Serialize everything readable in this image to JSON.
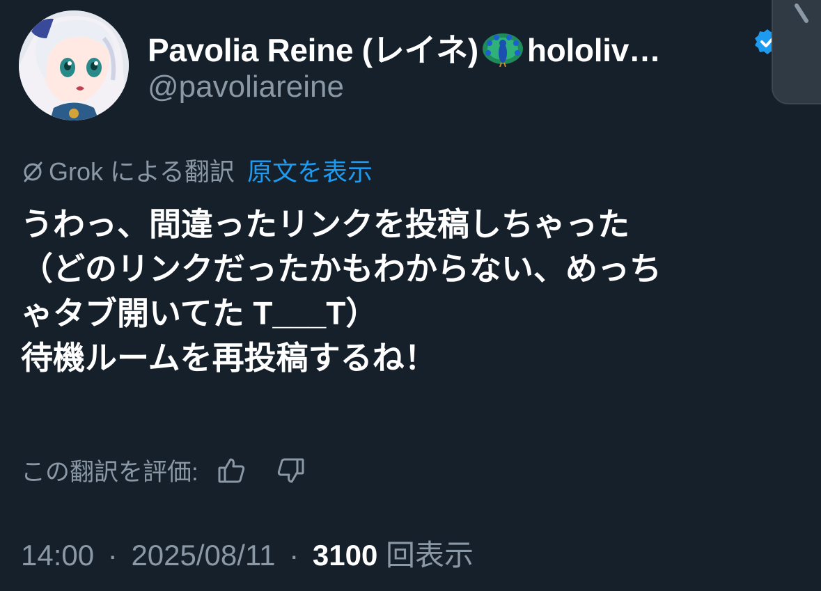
{
  "author": {
    "display_name_prefix": "Pavolia Reine (レイネ)",
    "display_name_suffix": "hololiv…",
    "handle": "@pavoliareine",
    "peacock_emoji": "peacock-icon",
    "verified_icon": "verified-badge-icon",
    "verified_color": "#1d9bf0"
  },
  "translation": {
    "label": "Grok による翻訳",
    "show_original": "原文を表示",
    "icon": "grok-icon"
  },
  "tweet": {
    "lines": [
      "うわっ、間違ったリンクを投稿しちゃった",
      "（どのリンクだったかもわからない、めっち",
      "ゃタブ開いてた T___T）",
      "待機ルームを再投稿するね！"
    ]
  },
  "rating": {
    "label": "この翻訳を評価:",
    "thumbs_up_icon": "thumbs-up-icon",
    "thumbs_down_icon": "thumbs-down-icon"
  },
  "meta": {
    "time": "14:00",
    "dot1": "·",
    "date": "2025/08/11",
    "dot2": "·",
    "views_count": "3100",
    "views_label": "回表示"
  },
  "colors": {
    "background": "#15202b",
    "text_primary": "#ffffff",
    "text_secondary": "#8b98a5",
    "accent": "#1d9bf0"
  }
}
